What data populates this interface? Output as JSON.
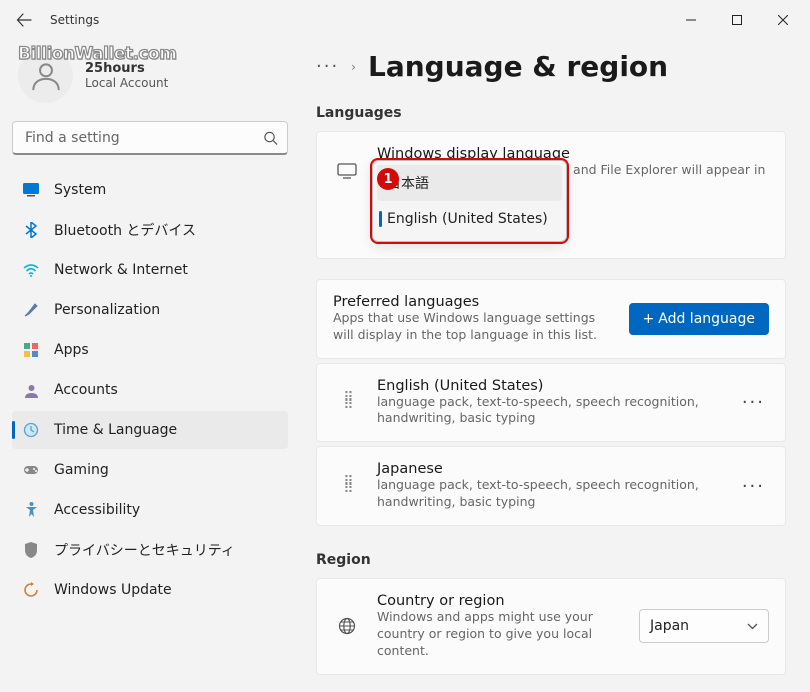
{
  "titlebar": {
    "title": "Settings"
  },
  "profile": {
    "name": "25hours",
    "sub": "Local Account"
  },
  "watermark": "BillionWallet.com",
  "search": {
    "placeholder": "Find a setting"
  },
  "sidebar": {
    "items": [
      {
        "label": "System"
      },
      {
        "label": "Bluetooth とデバイス"
      },
      {
        "label": "Network & Internet"
      },
      {
        "label": "Personalization"
      },
      {
        "label": "Apps"
      },
      {
        "label": "Accounts"
      },
      {
        "label": "Time & Language"
      },
      {
        "label": "Gaming"
      },
      {
        "label": "Accessibility"
      },
      {
        "label": "プライバシーとセキュリティ"
      },
      {
        "label": "Windows Update"
      }
    ]
  },
  "breadcrumb": {
    "more": "···",
    "chev": "›",
    "title": "Language & region"
  },
  "sections": {
    "languages_label": "Languages",
    "region_label": "Region",
    "display_language": {
      "title": "Windows display language",
      "sub": "Windows features like Settings and File Explorer will appear in this",
      "callout": "1",
      "options": [
        "日本語",
        "English (United States)"
      ]
    },
    "preferred": {
      "title": "Preferred languages",
      "sub": "Apps that use Windows language settings will display in the top language in this list.",
      "add_btn": "Add language"
    },
    "lang_items": [
      {
        "title": "English (United States)",
        "sub": "language pack, text-to-speech, speech recognition, handwriting, basic typing"
      },
      {
        "title": "Japanese",
        "sub": "language pack, text-to-speech, speech recognition, handwriting, basic typing"
      }
    ],
    "region": {
      "title": "Country or region",
      "sub": "Windows and apps might use your country or region to give you local content.",
      "value": "Japan"
    }
  }
}
